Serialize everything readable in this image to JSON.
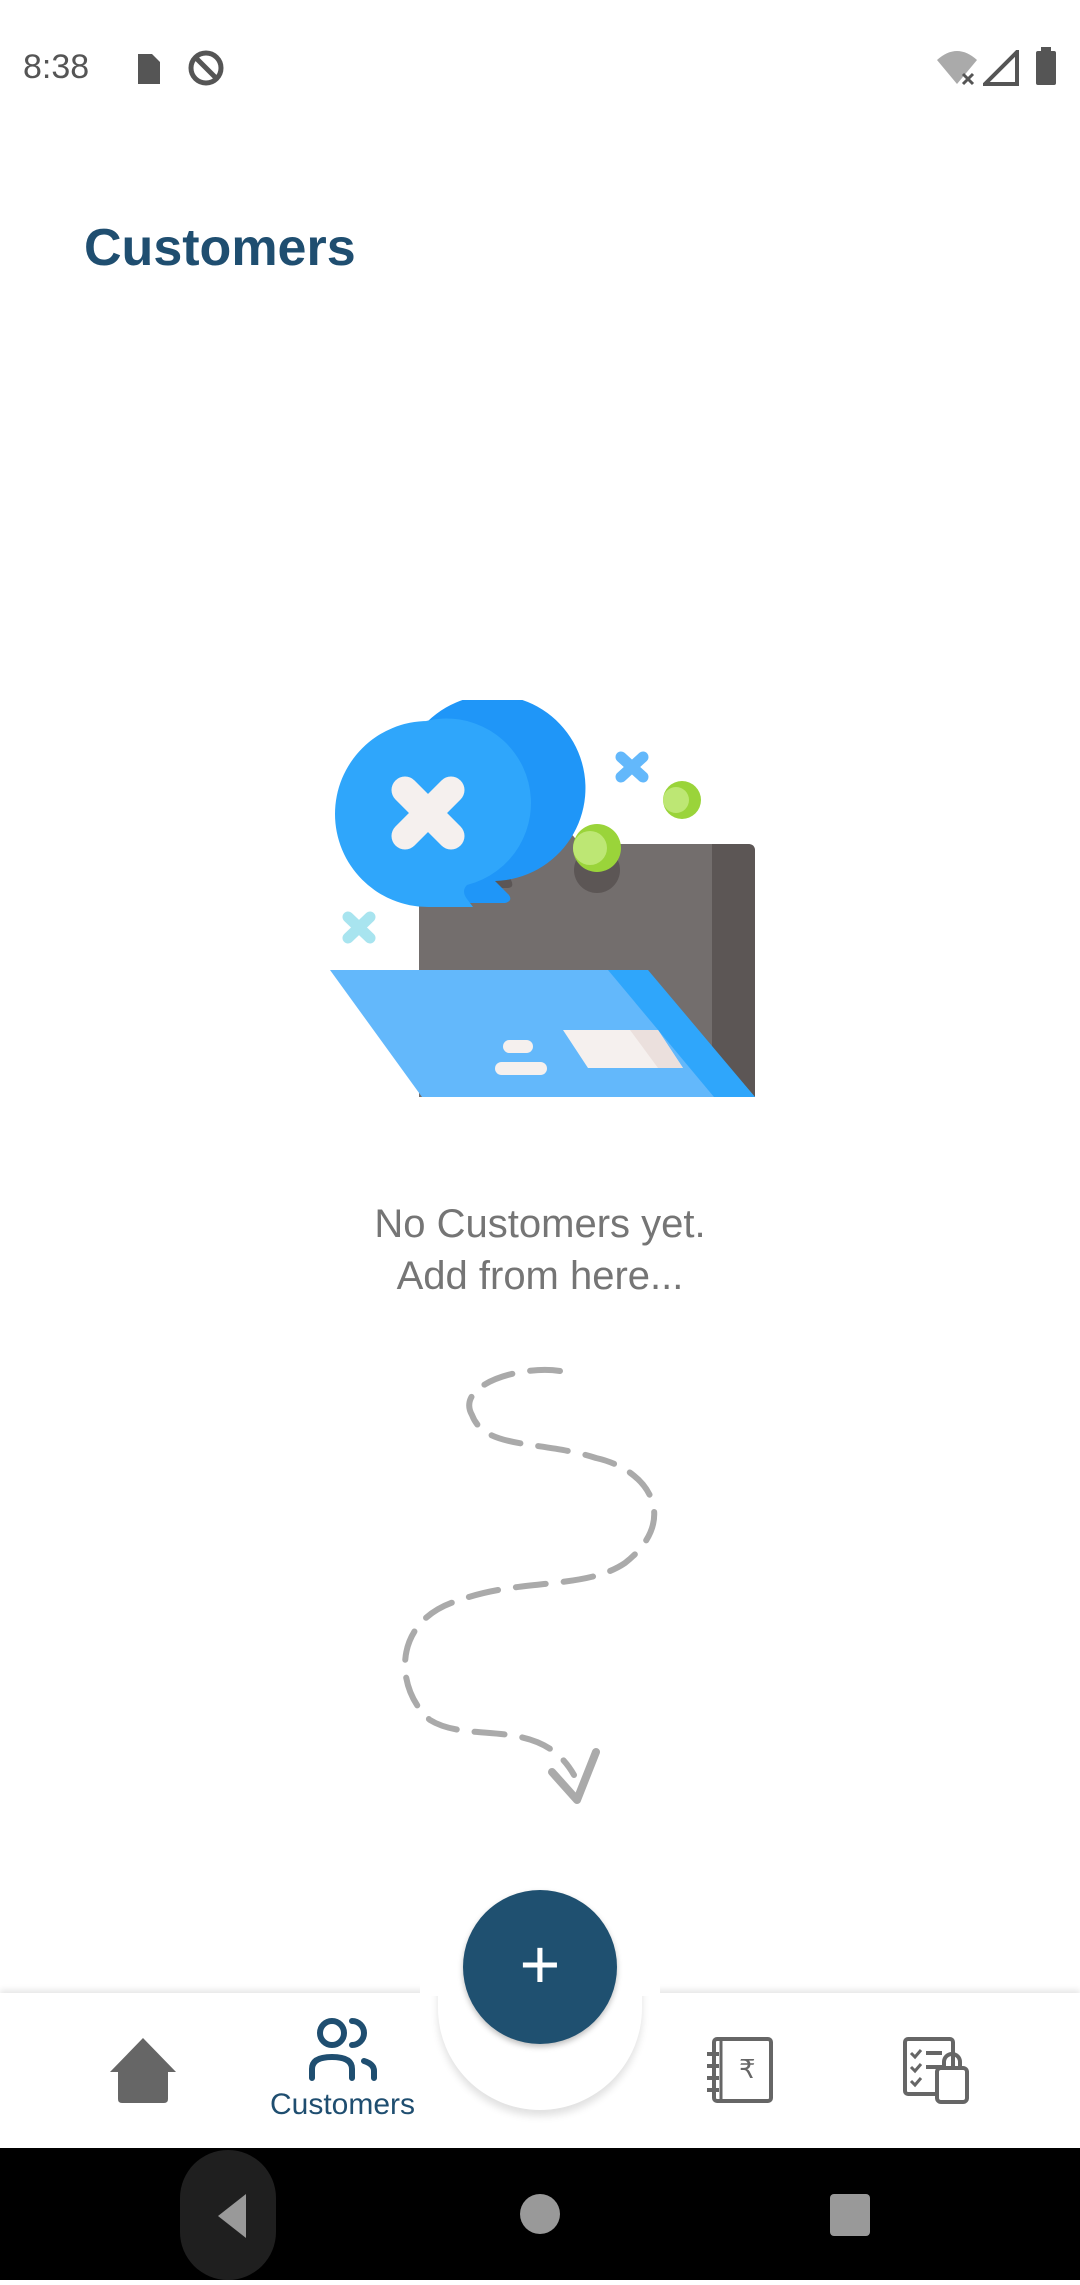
{
  "status_bar": {
    "time": "8:38",
    "icons": [
      "sd-card-icon",
      "no-sync-icon",
      "wifi-off-icon",
      "signal-icon",
      "battery-icon"
    ]
  },
  "page": {
    "title": "Customers"
  },
  "empty_state": {
    "line1": "No Customers yet.",
    "line2": "Add from here..."
  },
  "fab": {
    "label": "+"
  },
  "bottom_nav": {
    "items": [
      {
        "icon": "home-icon"
      },
      {
        "icon": "customers-icon",
        "label": "Customers",
        "active": true
      },
      {
        "icon": "rupee-ledger-icon"
      },
      {
        "icon": "checklist-bag-icon"
      }
    ]
  },
  "colors": {
    "primary": "#1f4e70",
    "inactive": "#666666"
  }
}
